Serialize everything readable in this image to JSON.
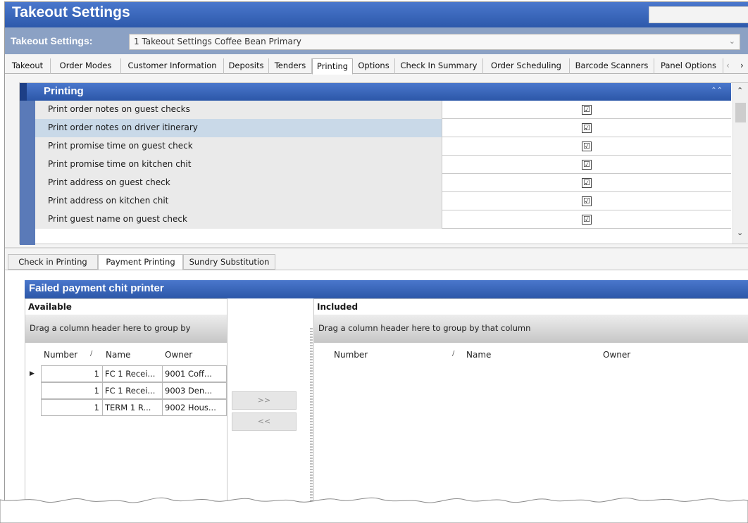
{
  "window": {
    "title": "Takeout Settings"
  },
  "selector": {
    "label": "Takeout Settings:",
    "value": "1 Takeout Settings Coffee Bean Primary"
  },
  "tabs": [
    "Takeout",
    "Order Modes",
    "Customer Information",
    "Deposits",
    "Tenders",
    "Printing",
    "Options",
    "Check In Summary",
    "Order Scheduling",
    "Barcode Scanners",
    "Panel Options"
  ],
  "active_tab": "Printing",
  "printing": {
    "title": "Printing",
    "rows": [
      {
        "label": "Print order notes on guest checks",
        "checked": "☑"
      },
      {
        "label": "Print order notes on driver itinerary",
        "checked": "☑"
      },
      {
        "label": "Print promise time on guest check",
        "checked": "☑"
      },
      {
        "label": "Print promise time on kitchen chit",
        "checked": "☑"
      },
      {
        "label": "Print address on guest check",
        "checked": "☑"
      },
      {
        "label": "Print address on kitchen chit",
        "checked": "☑"
      },
      {
        "label": "Print guest name on guest check",
        "checked": "☑"
      }
    ]
  },
  "subtabs": [
    "Check in Printing",
    "Payment Printing",
    "Sundry Substitution"
  ],
  "active_subtab": "Payment Printing",
  "failed_payment": {
    "title": "Failed payment chit printer",
    "available": {
      "title": "Available",
      "drag_hint": "Drag a column header here to group by",
      "columns": [
        "Number",
        "Name",
        "Owner"
      ],
      "rows": [
        [
          "1",
          "FC 1 Recei...",
          "9001 Coff..."
        ],
        [
          "1",
          "FC 1 Recei...",
          "9003 Den..."
        ],
        [
          "1",
          "TERM 1 R...",
          "9002 Hous..."
        ]
      ]
    },
    "buttons": {
      "add": ">>",
      "remove": "<<"
    },
    "included": {
      "title": "Included",
      "drag_hint": "Drag a column header here to group by that column",
      "columns": [
        "Number",
        "Name",
        "Owner"
      ]
    }
  },
  "colors": {
    "header_blue": "#3b68bd",
    "selector_bar": "#8ba1c4",
    "selected_row": "#c9d9e8"
  }
}
